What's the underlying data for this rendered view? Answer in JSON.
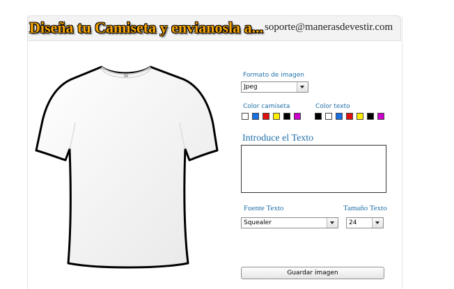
{
  "header": {
    "title": "Diseña tu Camiseta y envianosla a...",
    "email": "soporte@manerasdevestir.com"
  },
  "form": {
    "format_label": "Formato de imagen",
    "format_value": "Jpeg",
    "shirt_color_label": "Color camiseta",
    "text_color_label": "Color texto",
    "text_input_label": "Introduce el Texto",
    "text_value": "",
    "font_label": "Fuente Texto",
    "font_value": "Squealer",
    "size_label": "Tamaño Texto",
    "size_value": "24",
    "save_label": "Guardar imagen"
  },
  "shirt_colors": [
    "#ffffff",
    "#1a6fe0",
    "#e01010",
    "#ffee00",
    "#000000",
    "#cc00cc"
  ],
  "text_colors": [
    "#000000",
    "#ffffff",
    "#1a6fe0",
    "#e01010",
    "#ffee00",
    "#000000",
    "#cc00cc"
  ]
}
